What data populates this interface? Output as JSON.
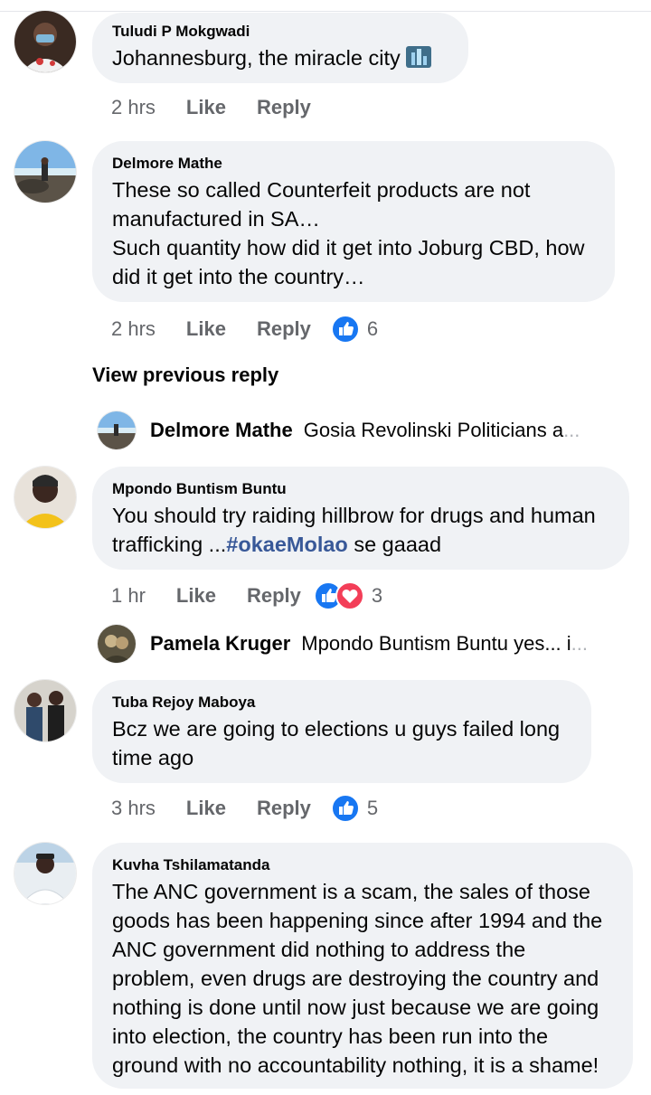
{
  "comments": [
    {
      "author": "Tuludi P Mokgwadi",
      "text": "Johannesburg, the miracle city",
      "time": "2 hrs",
      "like": "Like",
      "reply": "Reply"
    },
    {
      "author": "Delmore Mathe",
      "text": "These so called Counterfeit products are not manufactured in SA…\nSuch quantity how did it get into Joburg CBD, how did it get into the country…",
      "time": "2 hrs",
      "like": "Like",
      "reply": "Reply",
      "reaction_count": "6",
      "reaction_icons": [
        "like-icon"
      ]
    },
    {
      "author": "Mpondo Buntism Buntu",
      "text_prefix": "You should try raiding hillbrow for drugs and human trafficking ...",
      "hashtag": "#okaeMolao",
      "text_suffix": " se gaaad",
      "time": "1 hr",
      "like": "Like",
      "reply": "Reply",
      "reaction_count": "3",
      "reaction_icons": [
        "like-icon",
        "love-icon"
      ]
    },
    {
      "author": "Tuba Rejoy Maboya",
      "text": "Bcz we are going to elections u guys failed long time ago",
      "time": "3 hrs",
      "like": "Like",
      "reply": "Reply",
      "reaction_count": "5",
      "reaction_icons": [
        "like-icon"
      ]
    },
    {
      "author": "Kuvha Tshilamatanda",
      "text": "The ANC government is a scam, the sales of those goods has been happening since after 1994 and the ANC government did nothing to address the problem, even drugs are destroying the country and nothing is done until now just because we are going into election, the country has been run into the ground with no accountability nothing, it is a shame!"
    }
  ],
  "view_previous_reply": "View previous reply",
  "replies": [
    {
      "name": "Delmore Mathe",
      "preview": "Gosia Revolinski Politicians a",
      "ellipsis": "..."
    },
    {
      "name": "Pamela Kruger",
      "preview": "Mpondo Buntism Buntu yes... i",
      "ellipsis": "..."
    }
  ],
  "colors": {
    "bubble": "#f0f2f5",
    "meta": "#65676b",
    "like_blue": "#1877f2",
    "love_red": "#f33e58",
    "hashtag": "#385898"
  }
}
